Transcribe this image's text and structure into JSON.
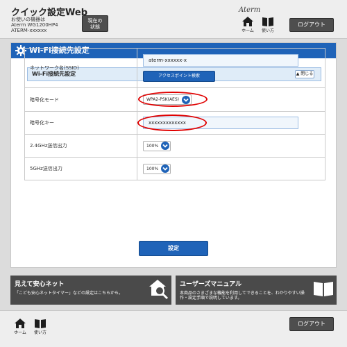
{
  "header": {
    "app_title": "クイック設定Web",
    "device_label": "お使いの機器は",
    "device_model": "Aterm WG1200HP4",
    "device_name": "ATERM-xxxxxx",
    "status_button": [
      "現在の",
      "状態"
    ],
    "home_label": "ホーム",
    "manual_label": "使い方",
    "brand": "Aterm",
    "logout_label": "ログアウト"
  },
  "page": {
    "title": "Wi-Fi接続先設定",
    "section_title": "Wi-Fi接続先設定",
    "close_label": "閉じる"
  },
  "form": {
    "ssid_label": "ネットワーク名(SSID)",
    "ssid_value": "aterm-xxxxxx-x",
    "ap_search_label": "アクセスポイント検索",
    "encryption_mode_label": "暗号化モード",
    "encryption_mode_value": "WPA2-PSK(AES)",
    "encryption_key_label": "暗号化キー",
    "encryption_key_value": "xxxxxxxxxxxxx",
    "tx_24_label": "2.4GHz送信出力",
    "tx_24_value": "100%",
    "tx_5_label": "5GHz送信出力",
    "tx_5_value": "100%",
    "submit_label": "設定"
  },
  "cards": {
    "safety_title": "見えて安心ネット",
    "safety_desc": "「こども安心ネットタイマー」などの設定はこちらから。",
    "manual_title": "ユーザーズマニュアル",
    "manual_desc_1": "本商品のさまざまな機能を利用してできることを、わかりやすい操",
    "manual_desc_2": "作・設定手順で説明しています。"
  },
  "footer": {
    "home_label": "ホーム",
    "manual_label": "使い方",
    "logout_label": "ログアウト"
  },
  "colors": {
    "primary_blue": "#1f63b8",
    "highlight_red": "#e00000",
    "dark_button": "#4e4e4e",
    "card_bg": "#4a4a4a"
  }
}
